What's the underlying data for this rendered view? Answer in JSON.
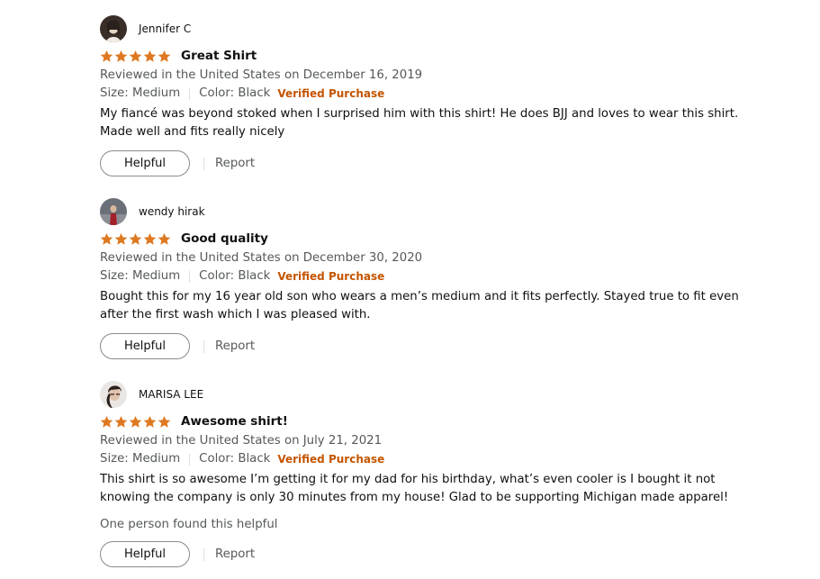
{
  "reviews": [
    {
      "author": "Jennifer C",
      "rating": 5,
      "title": "Great Shirt",
      "date": "Reviewed in the United States on December 16, 2019",
      "size": "Size: Medium",
      "color": "Color: Black",
      "verified": "Verified Purchase",
      "body_lines": [
        "My fiancé was beyond stoked when I surprised him with this shirt! He does BJJ and loves to wear this shirt.",
        "Made well and fits really nicely"
      ],
      "helpful_label": "Helpful",
      "report_label": "Report"
    },
    {
      "author": "wendy hirak",
      "rating": 5,
      "title": "Good quality",
      "date": "Reviewed in the United States on December 30, 2020",
      "size": "Size: Medium",
      "color": "Color: Black",
      "verified": "Verified Purchase",
      "body_lines": [
        "Bought this for my 16 year old son who wears a men’s medium and it fits perfectly. Stayed true to fit even",
        "after the first wash which I was pleased with."
      ],
      "helpful_label": "Helpful",
      "report_label": "Report"
    },
    {
      "author": "MARISA LEE",
      "rating": 5,
      "title": "Awesome shirt!",
      "date": "Reviewed in the United States on July 21, 2021",
      "size": "Size: Medium",
      "color": "Color: Black",
      "verified": "Verified Purchase",
      "body_lines": [
        "This shirt is so awesome I’m getting it for my dad for his birthday, what’s even cooler is I bought it not",
        "knowing the company is only 30 minutes from my house! Glad to be supporting Michigan made apparel!"
      ],
      "helpful_count": "One person found this helpful",
      "helpful_label": "Helpful",
      "report_label": "Report"
    }
  ],
  "colors": {
    "star": "#de7921",
    "verified": "#c45500",
    "meta": "#565959"
  },
  "icons": {
    "star": "star-icon",
    "avatar": "avatar"
  }
}
